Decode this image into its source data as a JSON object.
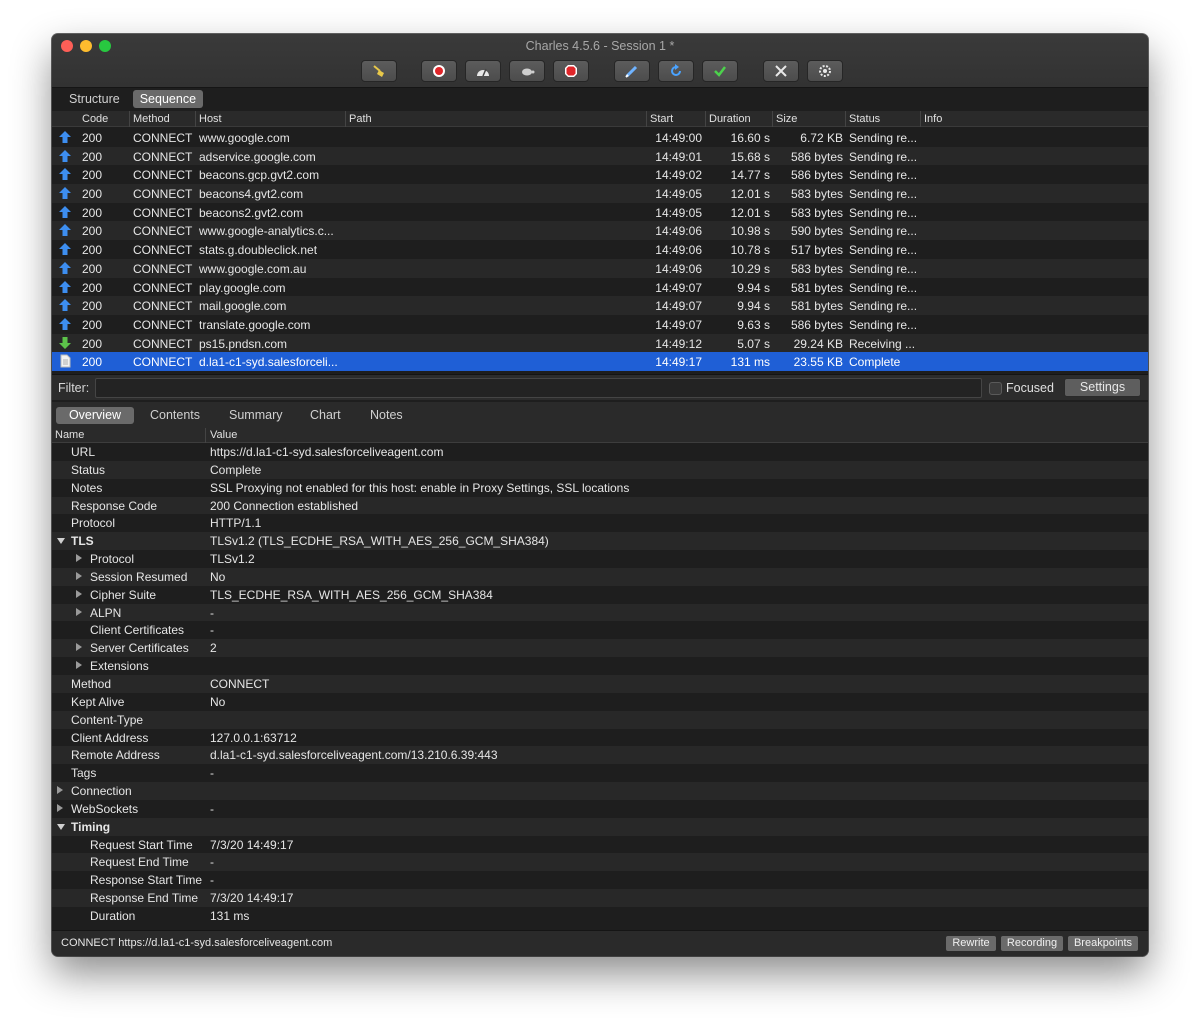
{
  "window": {
    "title": "Charles 4.5.6 - Session 1 *"
  },
  "toolbar": [
    {
      "name": "broom-icon"
    },
    {
      "name": "record-icon"
    },
    {
      "name": "throttle-icon"
    },
    {
      "name": "turtle-icon"
    },
    {
      "name": "breakpoint-icon"
    },
    {
      "name": "pen-icon"
    },
    {
      "name": "refresh-icon"
    },
    {
      "name": "check-icon"
    },
    {
      "name": "tools-icon"
    },
    {
      "name": "settings-gear-icon"
    }
  ],
  "view_tabs": {
    "structure": "Structure",
    "sequence": "Sequence"
  },
  "columns": {
    "code": "Code",
    "method": "Method",
    "host": "Host",
    "path": "Path",
    "start": "Start",
    "duration": "Duration",
    "size": "Size",
    "status": "Status",
    "info": "Info"
  },
  "requests": [
    {
      "icon": "up",
      "code": "200",
      "method": "CONNECT",
      "host": "www.google.com",
      "start": "14:49:00",
      "duration": "16.60 s",
      "size": "6.72 KB",
      "status": "Sending re..."
    },
    {
      "icon": "up",
      "code": "200",
      "method": "CONNECT",
      "host": "adservice.google.com",
      "start": "14:49:01",
      "duration": "15.68 s",
      "size": "586 bytes",
      "status": "Sending re..."
    },
    {
      "icon": "up",
      "code": "200",
      "method": "CONNECT",
      "host": "beacons.gcp.gvt2.com",
      "start": "14:49:02",
      "duration": "14.77 s",
      "size": "586 bytes",
      "status": "Sending re..."
    },
    {
      "icon": "up",
      "code": "200",
      "method": "CONNECT",
      "host": "beacons4.gvt2.com",
      "start": "14:49:05",
      "duration": "12.01 s",
      "size": "583 bytes",
      "status": "Sending re..."
    },
    {
      "icon": "up",
      "code": "200",
      "method": "CONNECT",
      "host": "beacons2.gvt2.com",
      "start": "14:49:05",
      "duration": "12.01 s",
      "size": "583 bytes",
      "status": "Sending re..."
    },
    {
      "icon": "up",
      "code": "200",
      "method": "CONNECT",
      "host": "www.google-analytics.c...",
      "start": "14:49:06",
      "duration": "10.98 s",
      "size": "590 bytes",
      "status": "Sending re..."
    },
    {
      "icon": "up",
      "code": "200",
      "method": "CONNECT",
      "host": "stats.g.doubleclick.net",
      "start": "14:49:06",
      "duration": "10.78 s",
      "size": "517 bytes",
      "status": "Sending re..."
    },
    {
      "icon": "up",
      "code": "200",
      "method": "CONNECT",
      "host": "www.google.com.au",
      "start": "14:49:06",
      "duration": "10.29 s",
      "size": "583 bytes",
      "status": "Sending re..."
    },
    {
      "icon": "up",
      "code": "200",
      "method": "CONNECT",
      "host": "play.google.com",
      "start": "14:49:07",
      "duration": "9.94 s",
      "size": "581 bytes",
      "status": "Sending re..."
    },
    {
      "icon": "up",
      "code": "200",
      "method": "CONNECT",
      "host": "mail.google.com",
      "start": "14:49:07",
      "duration": "9.94 s",
      "size": "581 bytes",
      "status": "Sending re..."
    },
    {
      "icon": "up",
      "code": "200",
      "method": "CONNECT",
      "host": "translate.google.com",
      "start": "14:49:07",
      "duration": "9.63 s",
      "size": "586 bytes",
      "status": "Sending re..."
    },
    {
      "icon": "down",
      "code": "200",
      "method": "CONNECT",
      "host": "ps15.pndsn.com",
      "start": "14:49:12",
      "duration": "5.07 s",
      "size": "29.24 KB",
      "status": "Receiving ..."
    },
    {
      "icon": "doc",
      "code": "200",
      "method": "CONNECT",
      "host": "d.la1-c1-syd.salesforceli...",
      "start": "14:49:17",
      "duration": "131 ms",
      "size": "23.55 KB",
      "status": "Complete"
    }
  ],
  "filter": {
    "label": "Filter:",
    "value": "",
    "focused_label": "Focused",
    "settings_label": "Settings"
  },
  "detail_tabs": {
    "overview": "Overview",
    "contents": "Contents",
    "summary": "Summary",
    "chart": "Chart",
    "notes": "Notes"
  },
  "detail_columns": {
    "name": "Name",
    "value": "Value"
  },
  "overview": [
    {
      "name": "URL",
      "value": "https://d.la1-c1-syd.salesforceliveagent.com",
      "level": 0,
      "toggle": "none",
      "bold": false
    },
    {
      "name": "Status",
      "value": "Complete",
      "level": 0,
      "toggle": "none",
      "bold": false
    },
    {
      "name": "Notes",
      "value": "SSL Proxying not enabled for this host: enable in Proxy Settings, SSL locations",
      "level": 0,
      "toggle": "none",
      "bold": false
    },
    {
      "name": "Response Code",
      "value": "200 Connection established",
      "level": 0,
      "toggle": "none",
      "bold": false
    },
    {
      "name": "Protocol",
      "value": "HTTP/1.1",
      "level": 0,
      "toggle": "none",
      "bold": false
    },
    {
      "name": "TLS",
      "value": "TLSv1.2 (TLS_ECDHE_RSA_WITH_AES_256_GCM_SHA384)",
      "level": 0,
      "toggle": "down",
      "bold": true
    },
    {
      "name": "Protocol",
      "value": "TLSv1.2",
      "level": 1,
      "toggle": "right",
      "bold": false
    },
    {
      "name": "Session Resumed",
      "value": "No",
      "level": 1,
      "toggle": "right",
      "bold": false
    },
    {
      "name": "Cipher Suite",
      "value": "TLS_ECDHE_RSA_WITH_AES_256_GCM_SHA384",
      "level": 1,
      "toggle": "right",
      "bold": false
    },
    {
      "name": "ALPN",
      "value": "-",
      "level": 1,
      "toggle": "right",
      "bold": false
    },
    {
      "name": "Client Certificates",
      "value": "-",
      "level": 1,
      "toggle": "none",
      "bold": false
    },
    {
      "name": "Server Certificates",
      "value": "2",
      "level": 1,
      "toggle": "right",
      "bold": false
    },
    {
      "name": "Extensions",
      "value": "",
      "level": 1,
      "toggle": "right",
      "bold": false
    },
    {
      "name": "Method",
      "value": "CONNECT",
      "level": 0,
      "toggle": "none",
      "bold": false
    },
    {
      "name": "Kept Alive",
      "value": "No",
      "level": 0,
      "toggle": "none",
      "bold": false
    },
    {
      "name": "Content-Type",
      "value": "",
      "level": 0,
      "toggle": "none",
      "bold": false
    },
    {
      "name": "Client Address",
      "value": "127.0.0.1:63712",
      "level": 0,
      "toggle": "none",
      "bold": false
    },
    {
      "name": "Remote Address",
      "value": "d.la1-c1-syd.salesforceliveagent.com/13.210.6.39:443",
      "level": 0,
      "toggle": "none",
      "bold": false
    },
    {
      "name": "Tags",
      "value": "-",
      "level": 0,
      "toggle": "none",
      "bold": false
    },
    {
      "name": "Connection",
      "value": "",
      "level": 0,
      "toggle": "right",
      "bold": false
    },
    {
      "name": "WebSockets",
      "value": "-",
      "level": 0,
      "toggle": "right",
      "bold": false
    },
    {
      "name": "Timing",
      "value": "",
      "level": 0,
      "toggle": "down",
      "bold": true
    },
    {
      "name": "Request Start Time",
      "value": "7/3/20 14:49:17",
      "level": 1,
      "toggle": "none",
      "bold": false
    },
    {
      "name": "Request End Time",
      "value": "-",
      "level": 1,
      "toggle": "none",
      "bold": false
    },
    {
      "name": "Response Start Time",
      "value": "-",
      "level": 1,
      "toggle": "none",
      "bold": false
    },
    {
      "name": "Response End Time",
      "value": "7/3/20 14:49:17",
      "level": 1,
      "toggle": "none",
      "bold": false
    },
    {
      "name": "Duration",
      "value": "131 ms",
      "level": 1,
      "toggle": "none",
      "bold": false
    }
  ],
  "statusbar": {
    "text": "CONNECT https://d.la1-c1-syd.salesforceliveagent.com",
    "rewrite": "Rewrite",
    "recording": "Recording",
    "breakpoints": "Breakpoints"
  },
  "colors": {
    "selected_row": "#1f5fd6",
    "up_arrow": "#3d8ef0",
    "down_arrow": "#5cc24a"
  }
}
